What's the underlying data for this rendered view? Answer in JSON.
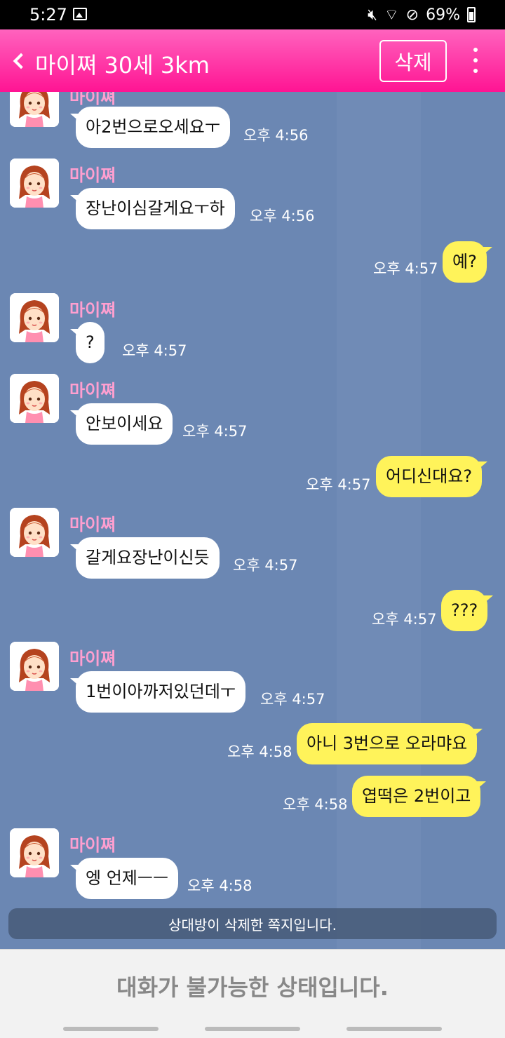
{
  "status_bar": {
    "time": "5:27",
    "battery": "69%",
    "icons": [
      "image-icon",
      "mute-icon",
      "wifi-icon",
      "do-not-disturb-icon",
      "battery-icon"
    ]
  },
  "header": {
    "title": "마이쪄 30세 3km",
    "delete_label": "삭제"
  },
  "messages": [
    {
      "from": "them",
      "name": "마이쪄",
      "text": "아2번으로오세요ㅜ",
      "time": "오후 4:56"
    },
    {
      "from": "them",
      "name": "마이쪄",
      "text": "장난이심갈게요ㅜ하",
      "time": "오후 4:56"
    },
    {
      "from": "me",
      "text": "예?",
      "time": "오후 4:57"
    },
    {
      "from": "them",
      "name": "마이쪄",
      "text": "?",
      "time": "오후 4:57"
    },
    {
      "from": "them",
      "name": "마이쪄",
      "text": "안보이세요",
      "time": "오후 4:57"
    },
    {
      "from": "me",
      "text": "어디신대요?",
      "time": "오후 4:57"
    },
    {
      "from": "them",
      "name": "마이쪄",
      "text": "갈게요장난이신듯",
      "time": "오후 4:57"
    },
    {
      "from": "me",
      "text": "???",
      "time": "오후 4:57"
    },
    {
      "from": "them",
      "name": "마이쪄",
      "text": "1번이아까저있던데ㅜ",
      "time": "오후 4:57"
    },
    {
      "from": "me",
      "text": "아니 3번으로 오라먀요",
      "time": "오후 4:58"
    },
    {
      "from": "me",
      "text": "엽떡은 2번이고",
      "time": "오후 4:58"
    },
    {
      "from": "them",
      "name": "마이쪄",
      "text": "엥 언제ㅡㅡ",
      "time": "오후 4:58"
    }
  ],
  "system_notice": "상대방이 삭제한 쪽지입니다.",
  "bottom_notice": "대화가 불가능한 상태입니다.",
  "colors": {
    "header": "#ff1493",
    "chat_background": "#6b87b3",
    "my_bubble": "#fff35a",
    "their_bubble": "#ffffff",
    "sender_name": "#ff9fd0"
  }
}
